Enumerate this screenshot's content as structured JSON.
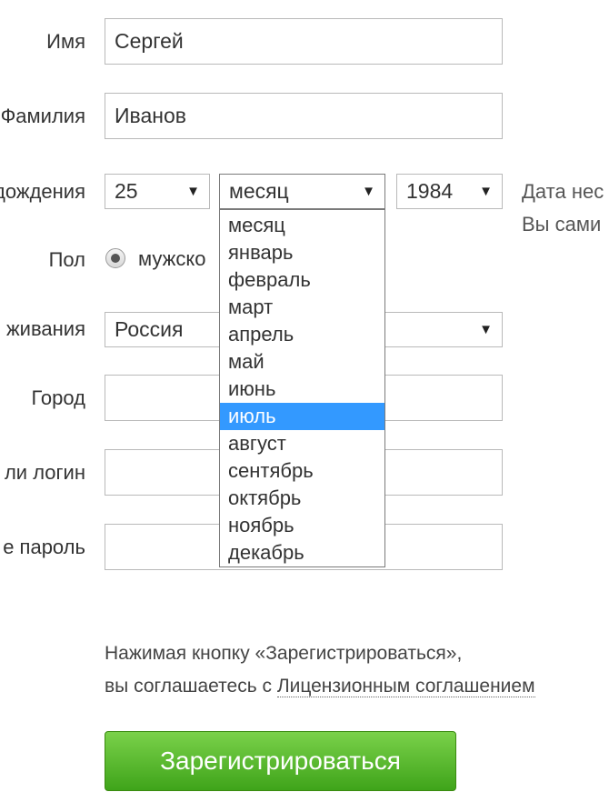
{
  "form": {
    "first_name": {
      "label": "Имя",
      "value": "Сергей"
    },
    "last_name": {
      "label": "Фамилия",
      "value": "Иванов"
    },
    "birth_date": {
      "label": "дождения",
      "day": "25",
      "month": "месяц",
      "year": "1984",
      "note_line1": "Дата нес",
      "note_line2": "Вы сами"
    },
    "gender": {
      "label": "Пол",
      "option": "мужско"
    },
    "country": {
      "label": "живания",
      "value": "Россия"
    },
    "city": {
      "label": "Город",
      "value": ""
    },
    "login": {
      "label": "ли логин",
      "value": ""
    },
    "password": {
      "label": "е пароль",
      "value": ""
    }
  },
  "month_dropdown": {
    "options": [
      "месяц",
      "январь",
      "февраль",
      "март",
      "апрель",
      "май",
      "июнь",
      "июль",
      "август",
      "сентябрь",
      "октябрь",
      "ноябрь",
      "декабрь"
    ],
    "selected": "июль"
  },
  "agreement": {
    "line1": "Нажимая кнопку «Зарегистрироваться»,",
    "line2_prefix": "вы соглашаетесь с ",
    "link": "Лицензионным соглашением"
  },
  "submit_label": "Зарегистрироваться",
  "icons": {
    "select_arrow": "▼"
  },
  "colors": {
    "submit_green": "#4caf22",
    "highlight_blue": "#3399ff"
  }
}
